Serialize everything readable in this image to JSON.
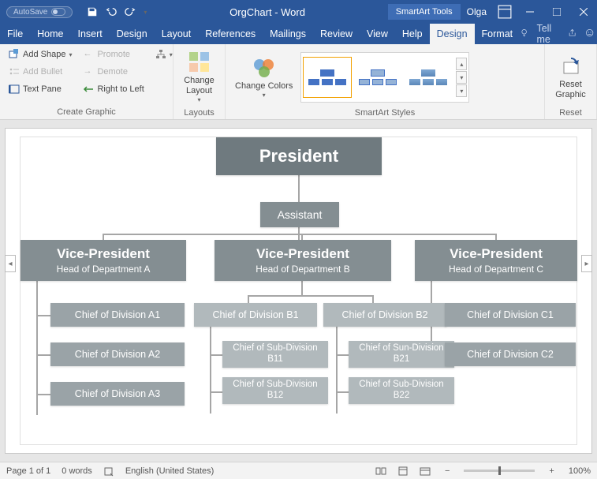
{
  "titlebar": {
    "autosave": "AutoSave",
    "doc_title": "OrgChart - Word",
    "contextual": "SmartArt Tools",
    "user": "Olga"
  },
  "menus": {
    "file": "File",
    "home": "Home",
    "insert": "Insert",
    "design_main": "Design",
    "layout": "Layout",
    "references": "References",
    "mailings": "Mailings",
    "review": "Review",
    "view": "View",
    "help": "Help",
    "sa_design": "Design",
    "sa_format": "Format",
    "tellme": "Tell me"
  },
  "ribbon": {
    "create": {
      "label": "Create Graphic",
      "add_shape": "Add Shape",
      "add_bullet": "Add Bullet",
      "text_pane": "Text Pane",
      "promote": "Promote",
      "demote": "Demote",
      "rtl": "Right to Left"
    },
    "layouts": {
      "label": "Layouts",
      "change_layout": "Change Layout"
    },
    "styles": {
      "label": "SmartArt Styles",
      "change_colors": "Change Colors"
    },
    "reset": {
      "label": "Reset",
      "reset_graphic": "Reset Graphic"
    }
  },
  "chart_data": {
    "type": "org-chart",
    "root": {
      "title": "President"
    },
    "assistant": {
      "title": "Assistant"
    },
    "vps": [
      {
        "title": "Vice-President",
        "sub": "Head of Department A",
        "children": [
          "Chief of Division A1",
          "Chief of Division A2",
          "Chief of Division A3"
        ]
      },
      {
        "title": "Vice-President",
        "sub": "Head of Department B",
        "children": [
          {
            "title": "Chief of Division B1",
            "subs": [
              "Chief of Sub-Division B11",
              "Chief of Sub-Division B12"
            ]
          },
          {
            "title": "Chief of Division B2",
            "subs": [
              "Chief of Sun-Division B21",
              "Chief of Sub-Division B22"
            ]
          }
        ]
      },
      {
        "title": "Vice-President",
        "sub": "Head of Department C",
        "children": [
          "Chief of Division C1",
          "Chief of Division C2"
        ]
      }
    ]
  },
  "status": {
    "page": "Page 1 of 1",
    "words": "0 words",
    "lang": "English (United States)",
    "zoom": "100%"
  }
}
